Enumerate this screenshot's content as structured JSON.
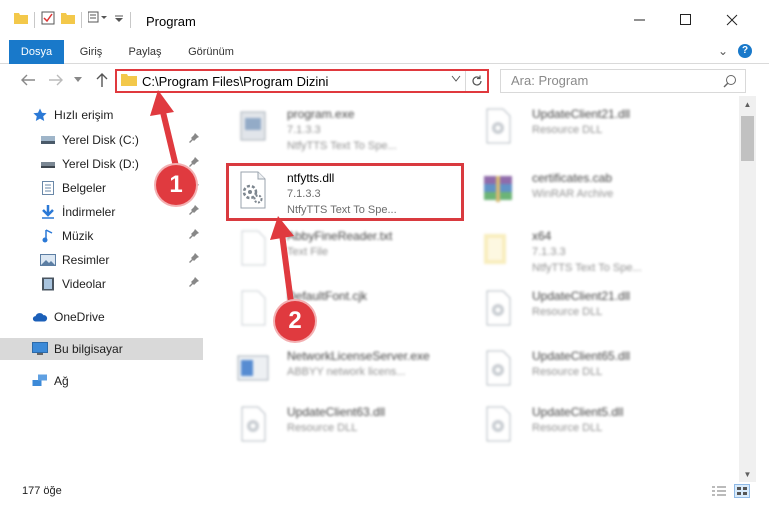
{
  "window": {
    "title": "Program",
    "minimize": "—",
    "maximize": "☐",
    "close": "✕"
  },
  "ribbon": {
    "tabs": [
      "Dosya",
      "Giriş",
      "Paylaş",
      "Görünüm"
    ],
    "collapse": "⌄",
    "help": "?"
  },
  "address": {
    "path": "C:\\Program Files\\Program Dizini",
    "search_placeholder": "Ara: Program"
  },
  "sidebar": {
    "items": [
      {
        "label": "Hızlı erişim",
        "icon": "star-icon",
        "pinned": false
      },
      {
        "label": "Yerel Disk (C:)",
        "icon": "drive-icon",
        "pinned": true
      },
      {
        "label": "Yerel Disk (D:)",
        "icon": "drive-icon",
        "pinned": true
      },
      {
        "label": "Belgeler",
        "icon": "documents-icon",
        "pinned": true
      },
      {
        "label": "İndirmeler",
        "icon": "downloads-icon",
        "pinned": true
      },
      {
        "label": "Müzik",
        "icon": "music-icon",
        "pinned": true
      },
      {
        "label": "Resimler",
        "icon": "pictures-icon",
        "pinned": true
      },
      {
        "label": "Videolar",
        "icon": "videos-icon",
        "pinned": true
      },
      {
        "label": "OneDrive",
        "icon": "onedrive-icon",
        "pinned": false
      },
      {
        "label": "Bu bilgisayar",
        "icon": "this-pc-icon",
        "pinned": false
      },
      {
        "label": "Ağ",
        "icon": "network-icon",
        "pinned": false
      }
    ]
  },
  "files": [
    {
      "name": "program.exe",
      "line2": "7.1.3.3",
      "line3": "NtfyTTS Text To Spe...",
      "icon": "exe-icon",
      "blurred": true
    },
    {
      "name": "UpdateClient21.dll",
      "line2": "Resource DLL",
      "line3": "",
      "icon": "dll-icon",
      "blurred": true
    },
    {
      "name": "ntfytts.dll",
      "line2": "7.1.3.3",
      "line3": "NtfyTTS Text To Spe...",
      "icon": "dll-icon",
      "blurred": false
    },
    {
      "name": "certificates.cab",
      "line2": "WinRAR Archive",
      "line3": "",
      "icon": "archive-icon",
      "blurred": true
    },
    {
      "name": "AbbyFineReader.txt",
      "line2": "Text File",
      "line3": "",
      "icon": "text-icon",
      "blurred": true
    },
    {
      "name": "x64",
      "line2": "7.1.3.3",
      "line3": "NtfyTTS Text To Spe...",
      "icon": "folder-icon",
      "blurred": true
    },
    {
      "name": "DefaultFont.cjk",
      "line2": "",
      "line3": "",
      "icon": "file-icon",
      "blurred": true
    },
    {
      "name": "UpdateClient21.dll",
      "line2": "Resource DLL",
      "line3": "",
      "icon": "dll-icon",
      "blurred": true
    },
    {
      "name": "NetworkLicenseServer.exe",
      "line2": "ABBYY network licens...",
      "line3": "",
      "icon": "exe-icon",
      "blurred": true
    },
    {
      "name": "UpdateClient65.dll",
      "line2": "Resource DLL",
      "line3": "",
      "icon": "dll-icon",
      "blurred": true
    },
    {
      "name": "UpdateClient63.dll",
      "line2": "Resource DLL",
      "line3": "",
      "icon": "dll-icon",
      "blurred": true
    },
    {
      "name": "UpdateClient5.dll",
      "line2": "Resource DLL",
      "line3": "",
      "icon": "dll-icon",
      "blurred": true
    }
  ],
  "status": {
    "item_count": "177 öğe"
  },
  "callouts": [
    "1",
    "2"
  ]
}
